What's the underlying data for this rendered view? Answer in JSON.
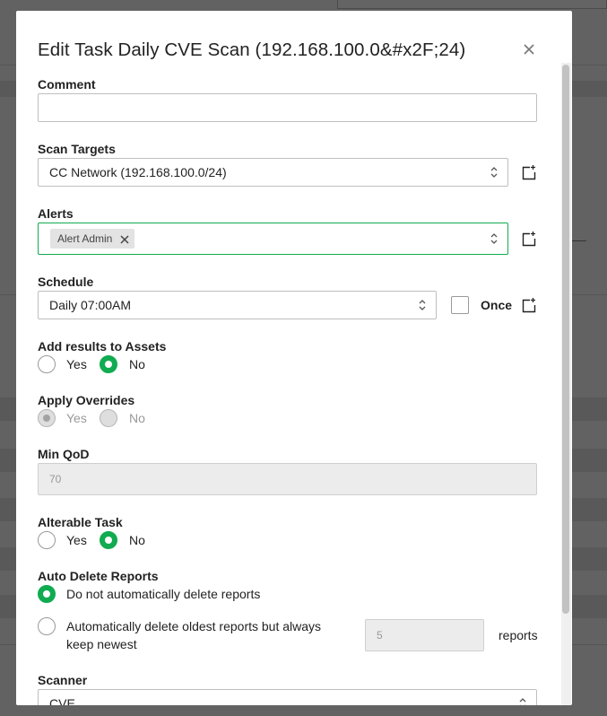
{
  "dialog": {
    "title": "Edit Task Daily CVE Scan (192.168.100.0&#x2F;24)",
    "close_icon": "close-icon"
  },
  "comment": {
    "label": "Comment",
    "value": ""
  },
  "scan_targets": {
    "label": "Scan Targets",
    "value": "CC Network (192.168.100.0/24)"
  },
  "alerts": {
    "label": "Alerts",
    "chips": [
      "Alert Admin"
    ]
  },
  "schedule": {
    "label": "Schedule",
    "value": "Daily 07:00AM",
    "once_label": "Once",
    "once_checked": false
  },
  "add_results": {
    "label": "Add results to Assets",
    "yes": "Yes",
    "no": "No",
    "selected": "No"
  },
  "apply_overrides": {
    "label": "Apply Overrides",
    "yes": "Yes",
    "no": "No",
    "selected": "Yes",
    "disabled": true
  },
  "min_qod": {
    "label": "Min QoD",
    "value": "70",
    "disabled": true
  },
  "alterable": {
    "label": "Alterable Task",
    "yes": "Yes",
    "no": "No",
    "selected": "No"
  },
  "auto_delete": {
    "label": "Auto Delete Reports",
    "option_1": "Do not automatically delete reports",
    "option_2_line1": "Automatically delete oldest reports but always",
    "option_2_line2": "keep newest",
    "keep_value": "5",
    "reports_label": "reports",
    "selected": "option_1"
  },
  "scanner": {
    "label": "Scanner",
    "value": "CVE"
  },
  "colors": {
    "accent": "#11ab51",
    "border": "#bfbfbf",
    "disabled_bg": "#ececec"
  }
}
